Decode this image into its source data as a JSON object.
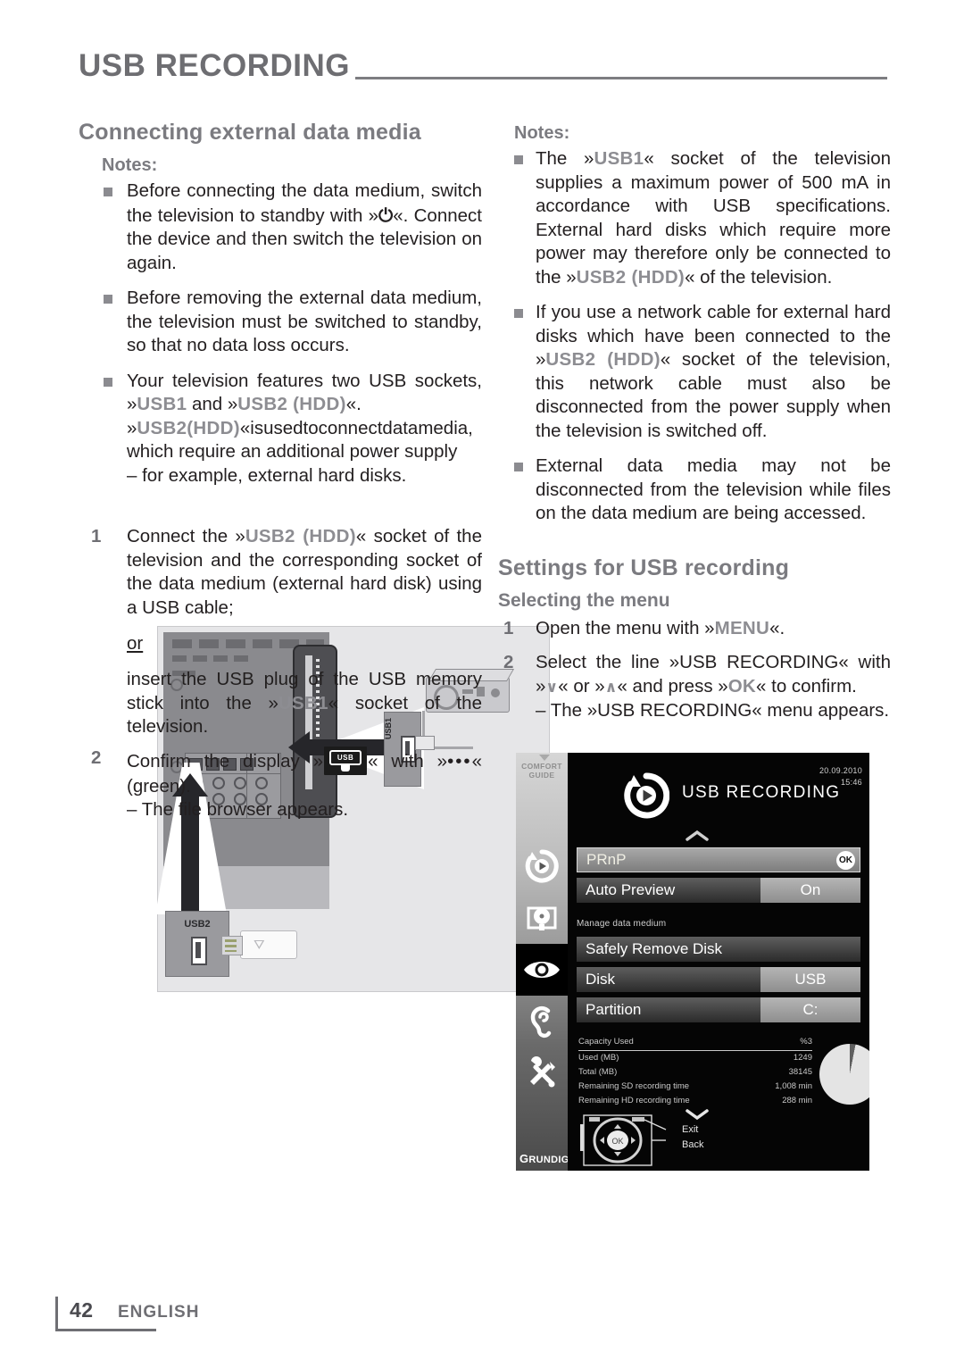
{
  "header": {
    "title": "USB RECORDING"
  },
  "left": {
    "section_title": "Connecting external data media",
    "notes_label": "Notes:",
    "notes": [
      {
        "pre": "Before connecting the data medium, switch the television to standby with »",
        "glyph": "⏻",
        "post": "«. Connect the device and then switch the television on again."
      },
      {
        "pre": "Before removing the external data medium, the television must be switched to standby, so that no data loss occurs.",
        "glyph": "",
        "post": ""
      }
    ],
    "note3": {
      "line1": "Your television features two USB sockets,",
      "key1": "USB1",
      "and": " and »",
      "key2": "USB2 (HDD)",
      "tail1": "«.",
      "key3": "USB2(HDD)",
      "line2": "«isusedtoconnectdatamedia, which require an additional power supply",
      "line3": "– for example, external hard disks."
    },
    "steps": [
      {
        "num": "1",
        "pre": "Connect the »",
        "key": "USB2 (HDD)",
        "post": "« socket of the television and the corresponding socket of the data medium (external hard disk) using a USB cable;"
      }
    ],
    "or_text": "or",
    "alt_step": {
      "pre": "insert the USB plug of the USB memory stick into the »",
      "key": "USB1",
      "post": "« socket of the television."
    },
    "step2": {
      "num": "2",
      "pre": "Confirm the display »",
      "badge_label": "USB",
      "mid": "« with »",
      "green_dots": "•••",
      "post": "« (green).",
      "result": "– The file browser appears."
    }
  },
  "diagram": {
    "usb1_label": "USB1",
    "usb2_label": "USB2"
  },
  "right": {
    "notes_label": "Notes:",
    "note1": {
      "pre": "The »",
      "key1": "USB1",
      "mid": "« socket of the television supplies a maximum power of 500 mA in accordance with USB specifications. External hard disks which require more power may therefore only be connected to the »",
      "key2": "USB2 (HDD)",
      "post": "« of the television."
    },
    "note2": {
      "pre": "If you use a network cable for external hard disks which have been connected to the »",
      "key": "USB2 (HDD)",
      "post": "« socket of the television, this network cable must also be disconnected from the power supply when the television is switched off."
    },
    "note3": "External data media may not be disconnected from the television while files on the data medium are being accessed.",
    "section_title": "Settings for USB recording",
    "sub_title": "Selecting the menu",
    "steps": [
      {
        "num": "1",
        "pre": "Open the menu with »",
        "key": "MENU",
        "post": "«."
      },
      {
        "num": "2",
        "pre": "Select the line »USB RECORDING« with »",
        "down": "∨",
        "mid": "« or »",
        "up": "∧",
        "mid2": "« and press »",
        "key": "OK",
        "post": "« to confirm.",
        "result": "– The »USB RECORDING« menu appears."
      }
    ]
  },
  "osd": {
    "comfort_guide": "COMFORT\nGUIDE",
    "comfort_guide_l1": "COMFORT",
    "comfort_guide_l2": "GUIDE",
    "title": "USB RECORDING",
    "date": "20.09.2010",
    "time": "15:46",
    "rows": [
      {
        "label": "PRnP",
        "value": "",
        "badge": "OK",
        "selected": true
      },
      {
        "label": "Auto Preview",
        "value": "On",
        "badge": "",
        "selected": false
      }
    ],
    "group_label": "Manage data medium",
    "rows2": [
      {
        "label": "Safely Remove Disk",
        "value": "",
        "badge": "",
        "selected": false
      },
      {
        "label": "Disk",
        "value": "USB",
        "badge": "",
        "selected": false
      },
      {
        "label": "Partition",
        "value": "C:",
        "badge": "",
        "selected": false
      }
    ],
    "capacity": [
      {
        "name": "Capacity Used",
        "value": "%3"
      },
      {
        "name": "Used (MB)",
        "value": "1249"
      },
      {
        "name": "Total (MB)",
        "value": "38145"
      },
      {
        "name": "Remaining SD recording time",
        "value": "1,008 min"
      },
      {
        "name": "Remaining HD recording time",
        "value": "288 min"
      }
    ],
    "nav_exit": "Exit",
    "nav_back": "Back",
    "ok_label": "OK",
    "brand_g": "G",
    "brand_rest": "RUNDIG"
  },
  "footer": {
    "page": "42",
    "language": "ENGLISH"
  }
}
